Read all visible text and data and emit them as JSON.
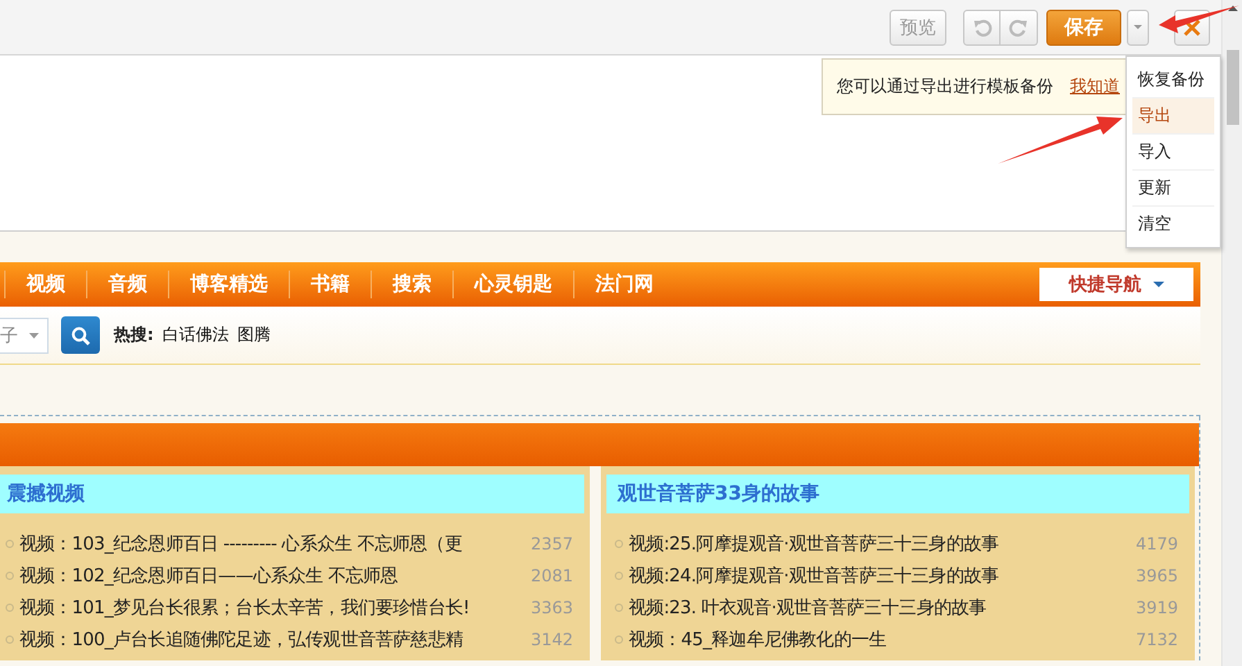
{
  "toolbar": {
    "preview": "预览",
    "save": "保存"
  },
  "notice": {
    "text": "您可以通过导出进行模板备份",
    "link": "我知道"
  },
  "menu": {
    "items": [
      {
        "label": "恢复备份",
        "selected": false
      },
      {
        "label": "导出",
        "selected": true
      },
      {
        "label": "导入",
        "selected": false
      },
      {
        "label": "更新",
        "selected": false
      },
      {
        "label": "清空",
        "selected": false
      }
    ]
  },
  "nav": {
    "items": [
      "视频",
      "音频",
      "博客精选",
      "书籍",
      "搜索",
      "心灵钥匙",
      "法门网"
    ],
    "quick_nav": "快捷导航"
  },
  "search": {
    "select_value": "子",
    "hot_label": "热搜:",
    "hot_terms": [
      "白话佛法",
      "图腾"
    ]
  },
  "columns": [
    {
      "title": "震撼视频",
      "rows": [
        {
          "title": "视频：103_纪念恩师百日 --------- 心系众生 不忘师恩（更",
          "count": "2357"
        },
        {
          "title": "视频：102_纪念恩师百日——心系众生 不忘师恩",
          "count": "2081"
        },
        {
          "title": "视频：101_梦见台长很累；台长太辛苦，我们要珍惜台长!",
          "count": "3363"
        },
        {
          "title": "视频：100_卢台长追随佛陀足迹，弘传观世音菩萨慈悲精",
          "count": "3142"
        }
      ]
    },
    {
      "title": "观世音菩萨33身的故事",
      "rows": [
        {
          "title": "视频:25.阿摩提观音·观世音菩萨三十三身的故事",
          "count": "4179"
        },
        {
          "title": "视频:24.阿摩提观音·观世音菩萨三十三身的故事",
          "count": "3965"
        },
        {
          "title": "视频:23. 叶衣观音·观世音菩萨三十三身的故事",
          "count": "3919"
        },
        {
          "title": "视频：45_释迦牟尼佛教化的一生",
          "count": "7132"
        }
      ]
    }
  ]
}
